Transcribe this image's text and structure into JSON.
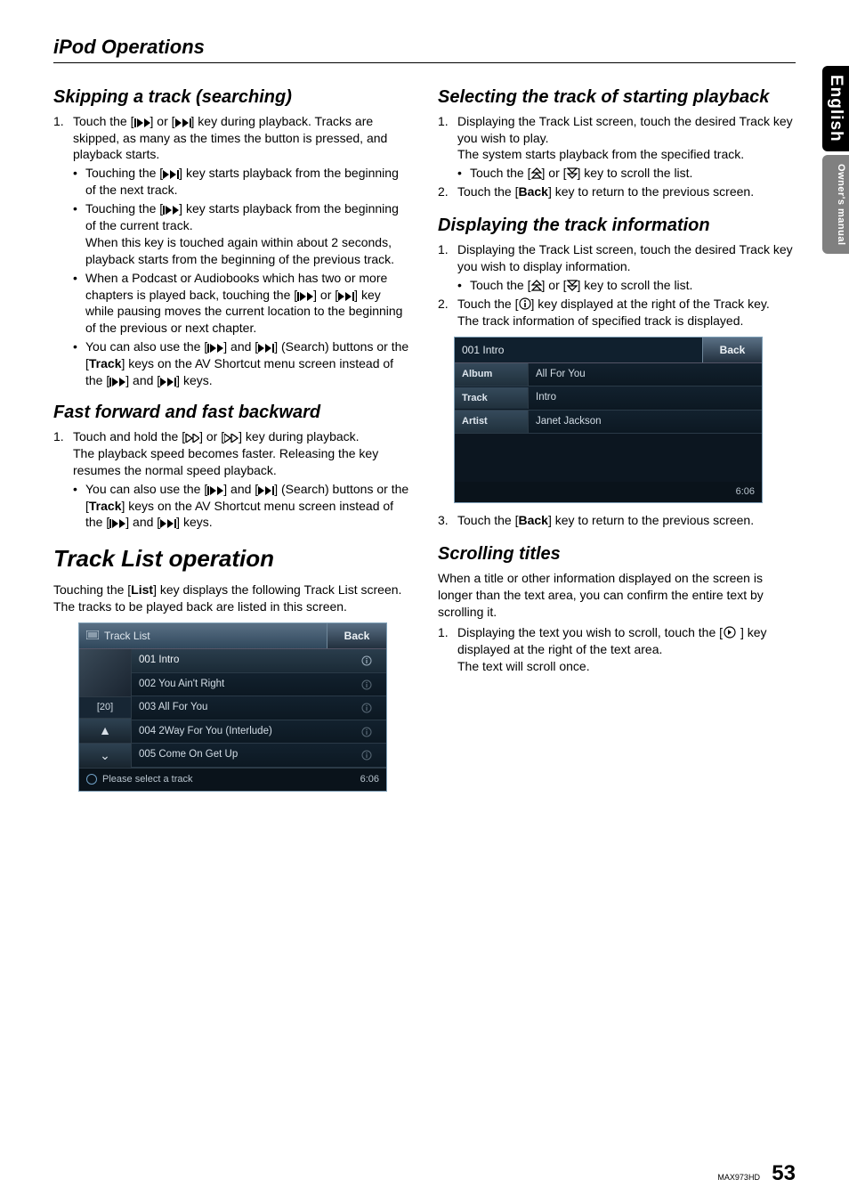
{
  "header": "iPod Operations",
  "side_tabs": {
    "lang": "English",
    "subtitle": "Owner's manual"
  },
  "footer": {
    "model": "MAX973HD",
    "page": "53"
  },
  "left": {
    "sec1": {
      "title": "Skipping a track (searching)",
      "n1_pre": "1.",
      "n1_a": "Touch the [",
      "n1_b": "] or [",
      "n1_c": "] key during playback. Tracks are skipped, as many as the times the button is pressed, and playback starts.",
      "b1_a": "Touching the [",
      "b1_b": "] key starts playback from the beginning of the next track.",
      "b2_a": "Touching the [",
      "b2_b": "] key starts playback from the beginning of the current track.",
      "b2_c": "When this key is touched again within about 2 seconds, playback starts from the beginning of the previous track.",
      "b3_a": "When a Podcast or Audiobooks which has two or more chapters is played back, touching the [",
      "b3_b": "] or [",
      "b3_c": "] key while pausing moves the current location to the beginning of the previous or next chapter.",
      "b4_a": "You can also use the [",
      "b4_b": "] and [",
      "b4_c": "] (Search) buttons or the [",
      "b4_track": "Track",
      "b4_d": "] keys on the AV Shortcut menu screen instead of the [",
      "b4_e": "] and [",
      "b4_f": "] keys."
    },
    "sec2": {
      "title": "Fast forward and fast backward",
      "n1_pre": "1.",
      "n1_a": "Touch and hold the [",
      "n1_b": "] or [",
      "n1_c": "] key during playback.",
      "n1_d": "The playback speed becomes faster. Releasing the key resumes the normal speed playback.",
      "b1_a": "You can also use the [",
      "b1_b": "] and [",
      "b1_c": "] (Search) buttons or the [",
      "b1_track": "Track",
      "b1_d": "] keys on the AV Shortcut menu screen instead of the [",
      "b1_e": "] and [",
      "b1_f": "] keys."
    },
    "sec3": {
      "title": "Track List operation",
      "intro_a": "Touching the [",
      "intro_list": "List",
      "intro_b": "] key displays the following Track List screen. The tracks to be played back are listed in this screen."
    },
    "ss1": {
      "title": "Track List",
      "back": "Back",
      "side_label": "[20]",
      "side_up": "▲",
      "side_down": "⌄",
      "rows": [
        "001 Intro",
        "002 You Ain't Right",
        "003 All For You",
        "004 2Way For You (Interlude)",
        "005 Come On Get Up"
      ],
      "footer_text": "Please select a track",
      "footer_time": "6:06"
    }
  },
  "right": {
    "sec1": {
      "title": "Selecting the track of starting playback",
      "n1_pre": "1.",
      "n1_a": "Displaying the Track List screen, touch the desired Track key you wish to play.",
      "n1_b": "The system starts playback from the specified track.",
      "b1_a": "Touch the [",
      "b1_b": "] or [",
      "b1_c": "] key to scroll the list.",
      "n2_pre": "2.",
      "n2_a": "Touch the [",
      "n2_back": "Back",
      "n2_b": "] key to return to the previous screen."
    },
    "sec2": {
      "title": "Displaying the track information",
      "n1_pre": "1.",
      "n1_a": "Displaying the Track List screen, touch the desired Track key you wish to display information.",
      "b1_a": "Touch the [",
      "b1_b": "] or [",
      "b1_c": "] key to scroll the list.",
      "n2_pre": "2.",
      "n2_a": "Touch the [",
      "n2_b": "] key displayed at the right of the Track key.",
      "n2_c": "The track information of specified track is displayed."
    },
    "ss2": {
      "title": "001 Intro",
      "back": "Back",
      "rows": [
        {
          "label": "Album",
          "value": "All For You"
        },
        {
          "label": "Track",
          "value": "Intro"
        },
        {
          "label": "Artist",
          "value": "Janet Jackson"
        }
      ],
      "footer_time": "6:06"
    },
    "sec2b": {
      "n3_pre": "3.",
      "n3_a": "Touch the [",
      "n3_back": "Back",
      "n3_b": "] key to return to the previous screen."
    },
    "sec3": {
      "title": "Scrolling titles",
      "intro": "When a title or other information displayed on the screen is longer than the text area, you can confirm the entire text by scrolling it.",
      "n1_pre": "1.",
      "n1_a": "Displaying the text you wish to scroll, touch the [",
      "n1_b": "] key displayed at the right of the text area.",
      "n1_c": "The text will scroll once."
    }
  }
}
